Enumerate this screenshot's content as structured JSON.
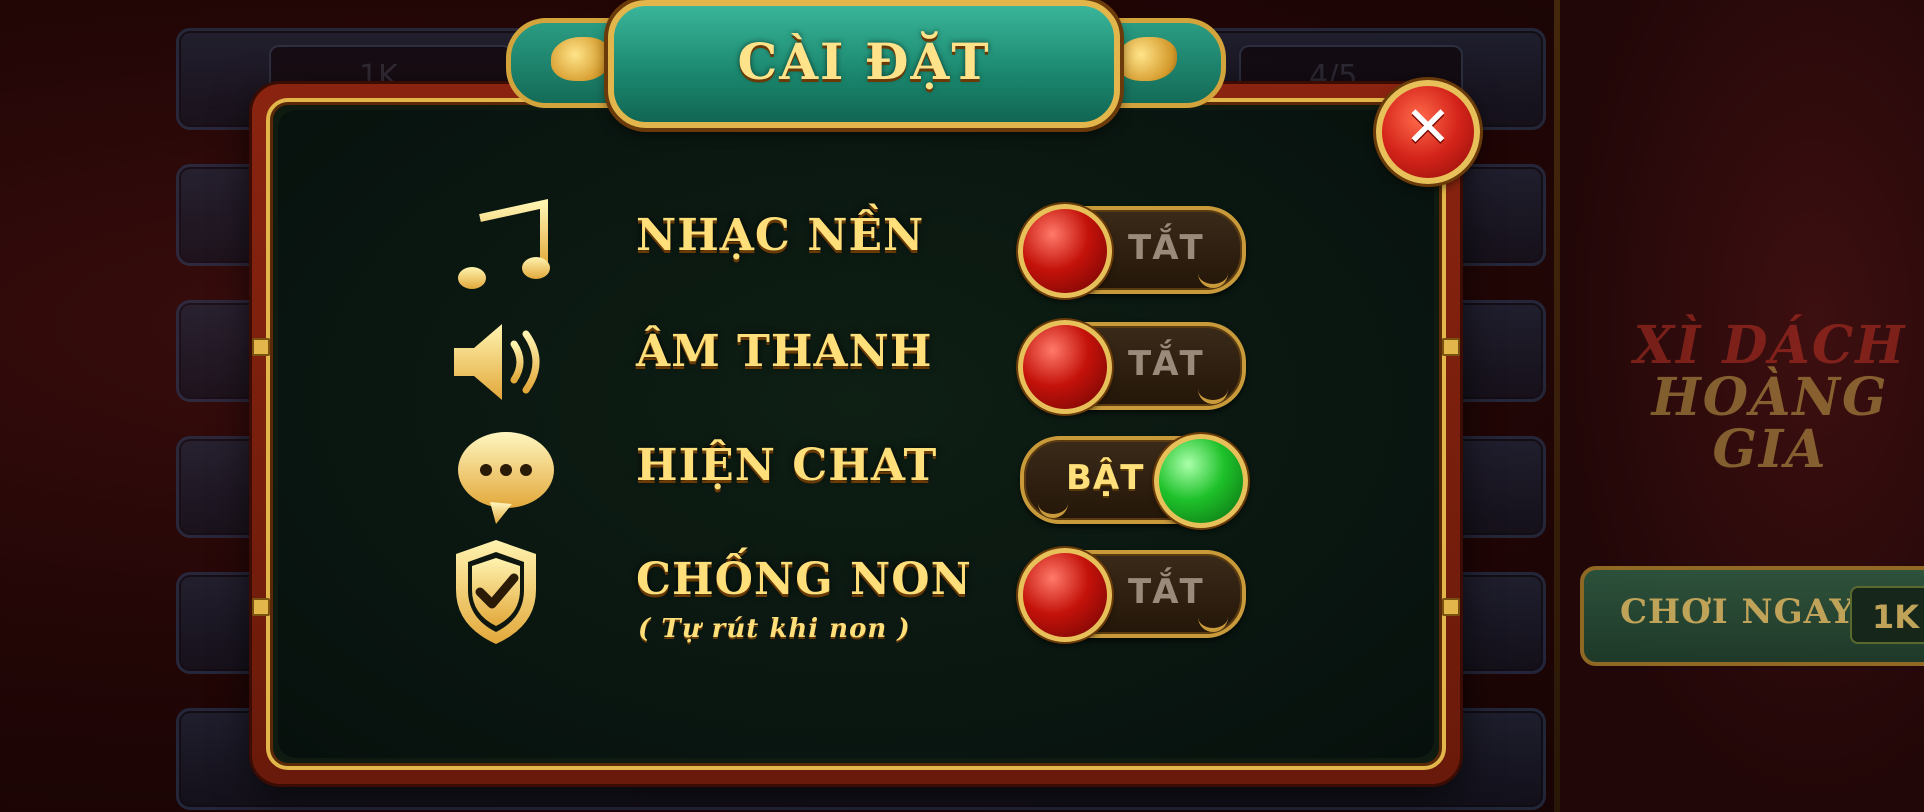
{
  "background": {
    "bets": [
      "1K",
      "4/5"
    ],
    "logo_line1": "XÌ DÁCH",
    "logo_line2": "HOÀNG GIA",
    "play_label": "CHƠI NGAY",
    "play_bet": "1K"
  },
  "dialog": {
    "title": "CÀI ĐẶT",
    "close_symbol": "✕"
  },
  "settings": [
    {
      "icon": "music-note-icon",
      "label": "NHẠC NỀN",
      "state": "TẮT",
      "enabled": false
    },
    {
      "icon": "speaker-icon",
      "label": "ÂM THANH",
      "state": "TẮT",
      "enabled": false
    },
    {
      "icon": "chat-bubble-icon",
      "label": "HIỆN CHAT",
      "state": "BẬT",
      "enabled": true
    },
    {
      "icon": "shield-check-icon",
      "label": "CHỐNG NON",
      "sublabel": "( Tự rút khi non )",
      "state": "TẮT",
      "enabled": false
    }
  ],
  "colors": {
    "label_gold": "#ffdf7a",
    "panel_green": "#0f1a10",
    "frame_red": "#8a2410",
    "toggle_off": "#c4120a",
    "toggle_on": "#1ec12a"
  }
}
